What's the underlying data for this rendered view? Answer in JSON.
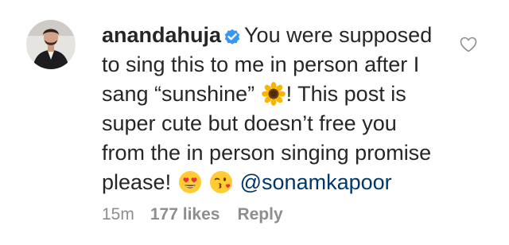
{
  "comment": {
    "username": "anandahuja",
    "verified_icon": "verified-badge-icon",
    "text_line1": "You were supposed",
    "text_line2": "to sing this to me in person after I",
    "text_line3_pre": "sang “sunshine”",
    "text_line3_post": "! This post is",
    "text_line4": "super cute but doesn’t free you",
    "text_line5": "from the in person singing promise",
    "text_line6": "please!",
    "mention": "@sonamkapoor",
    "emojis": [
      "sunflower-emoji",
      "heart-eyes-emoji",
      "kissing-face-emoji"
    ]
  },
  "meta": {
    "time": "15m",
    "likes": "177 likes",
    "reply": "Reply"
  },
  "colors": {
    "text": "#262626",
    "meta": "#8e8e8e",
    "mention": "#00376b",
    "verified": "#3897f0"
  }
}
